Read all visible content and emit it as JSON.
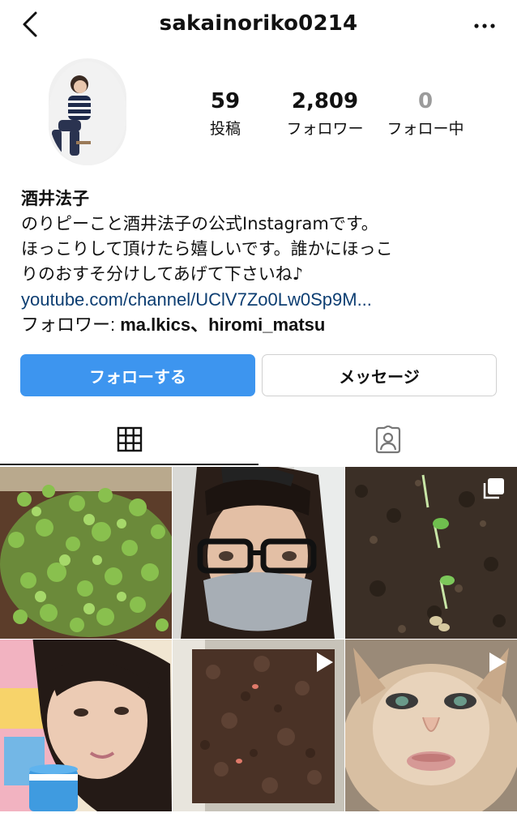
{
  "header": {
    "username": "sakainoriko0214"
  },
  "profile": {
    "stats": [
      {
        "value": "59",
        "label": "投稿"
      },
      {
        "value": "2,809",
        "label": "フォロワー"
      },
      {
        "value": "0",
        "label": "フォロー中"
      }
    ],
    "name": "酒井法子",
    "bio_lines": [
      "のりピーこと酒井法子の公式Instagramです。",
      "ほっこりして頂けたら嬉しいです。誰かにほっこ",
      "りのおすそ分けしてあげて下さいね♪"
    ],
    "link": "youtube.com/channel/UClV7Zo0Lw0Sp9M...",
    "followed_by_prefix": "フォロワー: ",
    "followed_by_users": "ma.lkics、hiromi_matsu"
  },
  "actions": {
    "follow_label": "フォローする",
    "message_label": "メッセージ"
  },
  "tabs": [
    {
      "icon": "grid-icon",
      "active": true
    },
    {
      "icon": "tagged-person-icon",
      "active": false
    }
  ],
  "posts": [
    {
      "subject": "sprouting seedlings",
      "badge": "none"
    },
    {
      "subject": "woman with glasses and mask",
      "badge": "none"
    },
    {
      "subject": "seedlings in soil",
      "badge": "carousel-icon"
    },
    {
      "subject": "woman holding cup",
      "badge": "none"
    },
    {
      "subject": "soil tray",
      "badge": "video-icon"
    },
    {
      "subject": "cat with face filter",
      "badge": "video-icon"
    }
  ]
}
